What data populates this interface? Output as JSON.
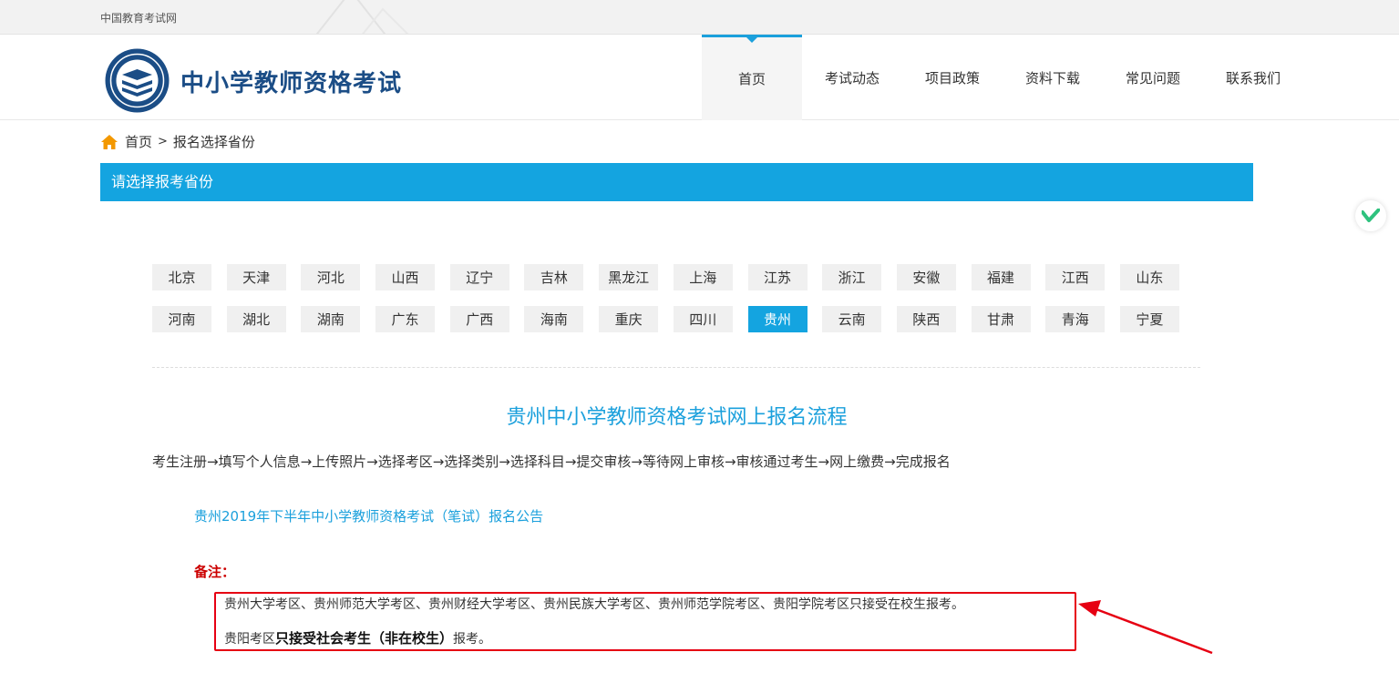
{
  "topbar": {
    "site_name": "中国教育考试网"
  },
  "header": {
    "brand": "中小学教师资格考试",
    "nav": [
      {
        "label": "首页",
        "active": true
      },
      {
        "label": "考试动态"
      },
      {
        "label": "项目政策"
      },
      {
        "label": "资料下载"
      },
      {
        "label": "常见问题"
      },
      {
        "label": "联系我们"
      }
    ]
  },
  "breadcrumb": {
    "home": "首页",
    "separator": ">",
    "current": "报名选择省份"
  },
  "section_title": "请选择报考省份",
  "provinces": {
    "row1": [
      "北京",
      "天津",
      "河北",
      "山西",
      "辽宁",
      "吉林",
      "黑龙江",
      "上海",
      "江苏",
      "浙江",
      "安徽",
      "福建",
      "江西",
      "山东"
    ],
    "row2": [
      "河南",
      "湖北",
      "湖南",
      "广东",
      "广西",
      "海南",
      "重庆",
      "四川",
      "贵州",
      "云南",
      "陕西",
      "甘肃",
      "青海",
      "宁夏"
    ],
    "selected": "贵州"
  },
  "flow": {
    "title": "贵州中小学教师资格考试网上报名流程",
    "steps": "考生注册→填写个人信息→上传照片→选择考区→选择类别→选择科目→提交审核→等待网上审核→审核通过考生→网上缴费→完成报名"
  },
  "notice_link": "贵州2019年下半年中小学教师资格考试（笔试）报名公告",
  "remark": {
    "label": "备注：",
    "line1": "贵州大学考区、贵州师范大学考区、贵州财经大学考区、贵州民族大学考区、贵州师范学院考区、贵阳学院考区只接受在校生报考。",
    "line2_prefix": "贵阳考区",
    "line2_bold": "只接受社会考生（非在校生）",
    "line2_suffix": "报考。"
  },
  "colors": {
    "accent": "#14a4e0",
    "brand": "#1b4d86",
    "highlight_border": "#e60012",
    "remark_label": "#cc0000"
  }
}
